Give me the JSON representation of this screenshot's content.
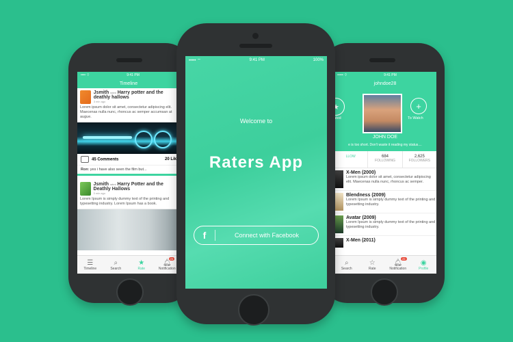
{
  "left_phone": {
    "status": {
      "carrier": "•••• ⌔",
      "time": "9:41 PM"
    },
    "header_title": "Timeline",
    "posts": [
      {
        "user": "Jsmith",
        "rated": "rated",
        "movie": "Harry potter and the deathly hallows",
        "time": "3 min ago",
        "text": "Lorem ipsum dolor sit amet, consectetur adipiscing elit. Maecenas nulla nunc, rhoncus ac semper accumsan at augue.",
        "comments": "45 Comments",
        "likes": "20 Lik",
        "comment_user": "Ron",
        "comment_text": ": yes i have also seen the film but..."
      },
      {
        "user": "Jsmith",
        "rated": "rated",
        "movie": "Harry Potter and the Deathly Hallows",
        "time": "3 min ago",
        "text": "Lorem Ipsum is simply dummy text of the printing and typesetting industry. Lorem Ipsum has a book."
      }
    ],
    "tabs": [
      {
        "label": "Timeline",
        "icon": "list-icon"
      },
      {
        "label": "Search",
        "icon": "search-icon"
      },
      {
        "label": "Rate",
        "icon": "star-icon"
      },
      {
        "label": "Notification",
        "icon": "bell-icon",
        "badge": "25"
      }
    ]
  },
  "center_phone": {
    "status": {
      "carrier": "••••• ⌔",
      "time": "9:41 PM",
      "battery": "100%"
    },
    "welcome": "Welcome to",
    "app_name": "Raters App",
    "fb_button": "Connect with Facebook",
    "fb_icon": "facebook-icon"
  },
  "right_phone": {
    "status": {
      "carrier": "••••• ⌔",
      "time": "9:41 PM"
    },
    "header_title": "johndoe28",
    "left_action": "ated",
    "right_action": "To Watch",
    "name": "JOHN DOE",
    "bio": "e is too short. Don't waste it reading my status....",
    "stats": [
      {
        "value": "",
        "label": "LLOW"
      },
      {
        "value": "684",
        "label": "FOLLOWING"
      },
      {
        "value": "2,625",
        "label": "FOLLOWERS"
      }
    ],
    "movies": [
      {
        "title": "X-Men (2000)",
        "text": "Lorem ipsum dolor sit amet, consectetur adipiscing elit. Maecenas nulla nunc, rhoncus ac semper."
      },
      {
        "title": "Blendness (2009)",
        "text": "Lorem Ipsum is simply dummy text of the printing and typesetting industry."
      },
      {
        "title": "Avatar (2009)",
        "text": "Lorem Ipsum is simply dummy text of the printing and typesetting industry."
      },
      {
        "title": "X-Men (2011)",
        "text": ""
      }
    ],
    "tabs": [
      {
        "label": "Search",
        "icon": "search-icon"
      },
      {
        "label": "Rate",
        "icon": "star-icon"
      },
      {
        "label": "Notification",
        "icon": "bell-icon",
        "badge": "25"
      },
      {
        "label": "Profile",
        "icon": "profile-icon"
      }
    ]
  },
  "colors": {
    "background": "#2bbf8d",
    "accent": "#3dd4a0",
    "phone": "#2f3233"
  }
}
